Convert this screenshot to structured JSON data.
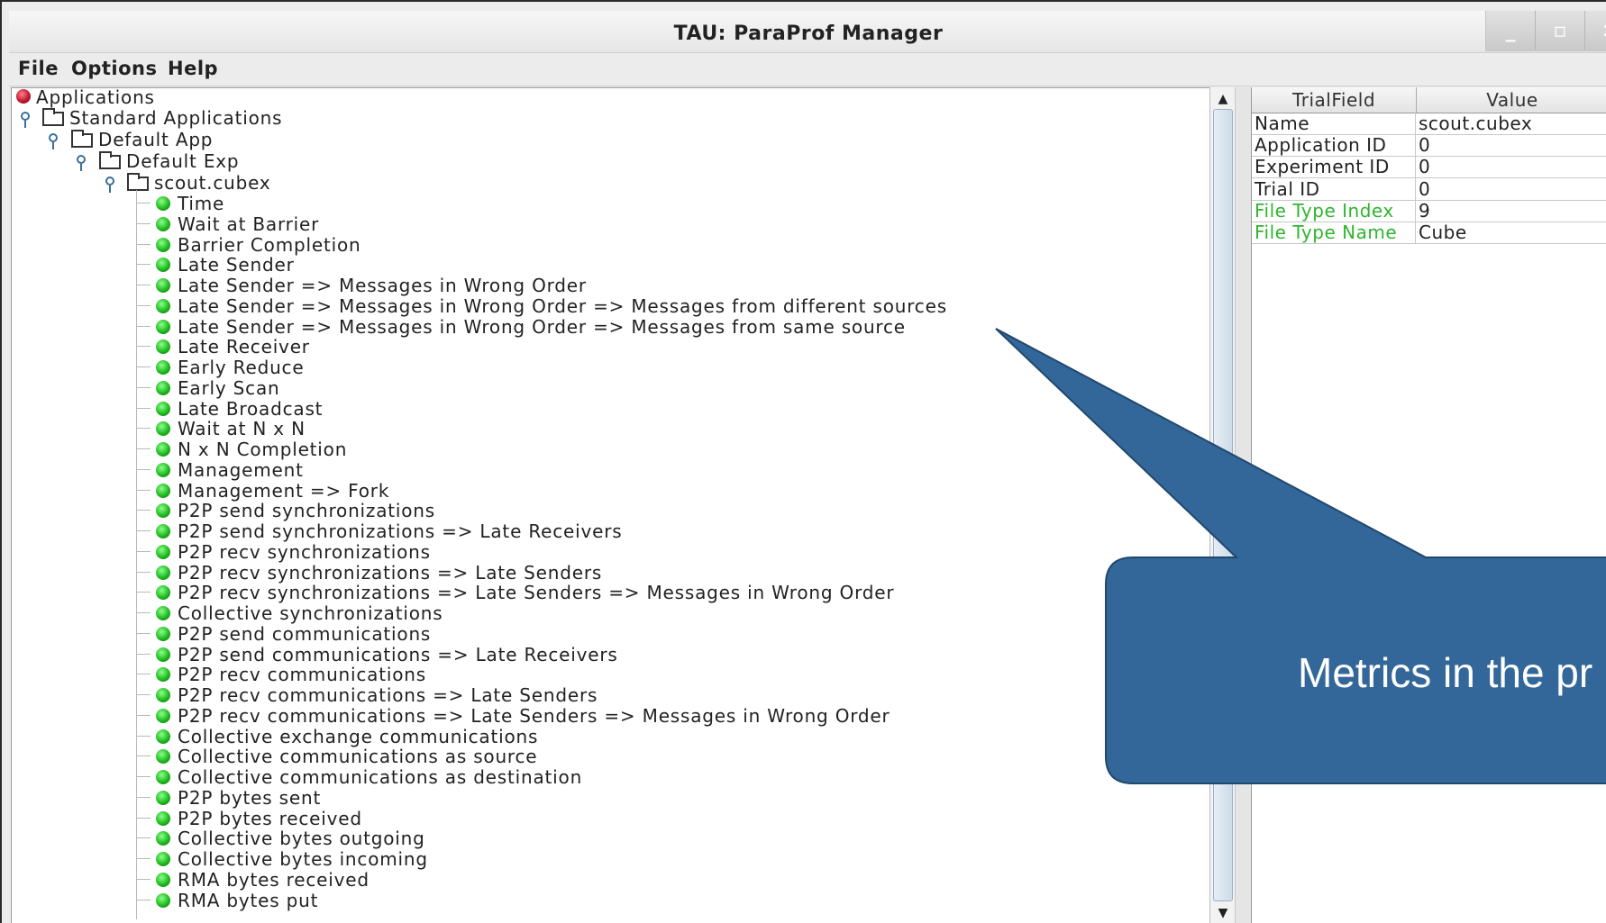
{
  "window": {
    "title": "TAU: ParaProf Manager",
    "controls": [
      "_",
      "▫",
      "×"
    ]
  },
  "menu": [
    "File",
    "Options",
    "Help"
  ],
  "tree": {
    "root": "Applications",
    "standard_apps": "Standard Applications",
    "app": "Default App",
    "experiment": "Default Exp",
    "trial": "scout.cubex",
    "metrics": [
      "Time",
      "Wait at Barrier",
      "Barrier Completion",
      "Late Sender",
      "Late Sender => Messages in Wrong Order",
      "Late Sender => Messages in Wrong Order => Messages from different sources",
      "Late Sender => Messages in Wrong Order => Messages from same source",
      "Late Receiver",
      "Early Reduce",
      "Early Scan",
      "Late Broadcast",
      "Wait at N x N",
      "N x N Completion",
      "Management",
      "Management => Fork",
      "P2P send synchronizations",
      "P2P send synchronizations => Late Receivers",
      "P2P recv synchronizations",
      "P2P recv synchronizations => Late Senders",
      "P2P recv synchronizations => Late Senders => Messages in Wrong Order",
      "Collective synchronizations",
      "P2P send communications",
      "P2P send communications => Late Receivers",
      "P2P recv communications",
      "P2P recv communications => Late Senders",
      "P2P recv communications => Late Senders => Messages in Wrong Order",
      "Collective exchange communications",
      "Collective communications as source",
      "Collective communications as destination",
      "P2P bytes sent",
      "P2P bytes received",
      "Collective bytes outgoing",
      "Collective bytes incoming",
      "RMA bytes received",
      "RMA bytes put"
    ]
  },
  "table": {
    "headers": [
      "TrialField",
      "Value"
    ],
    "rows": [
      {
        "field": "Name",
        "value": "scout.cubex",
        "color": "#222222"
      },
      {
        "field": "Application ID",
        "value": "0",
        "color": "#222222"
      },
      {
        "field": "Experiment ID",
        "value": "0",
        "color": "#222222"
      },
      {
        "field": "Trial ID",
        "value": "0",
        "color": "#222222"
      },
      {
        "field": "File Type Index",
        "value": "9",
        "color": "#2fb52f"
      },
      {
        "field": "File Type Name",
        "value": "Cube",
        "color": "#2fb52f"
      }
    ]
  },
  "callout": {
    "text": "Metrics in the pr",
    "fill": "#336699",
    "stroke": "#20486d"
  },
  "colors": {
    "metric_dot": "#1fbb1f",
    "root_dot": "#c2182f",
    "highlight_text": "#2fb52f"
  }
}
